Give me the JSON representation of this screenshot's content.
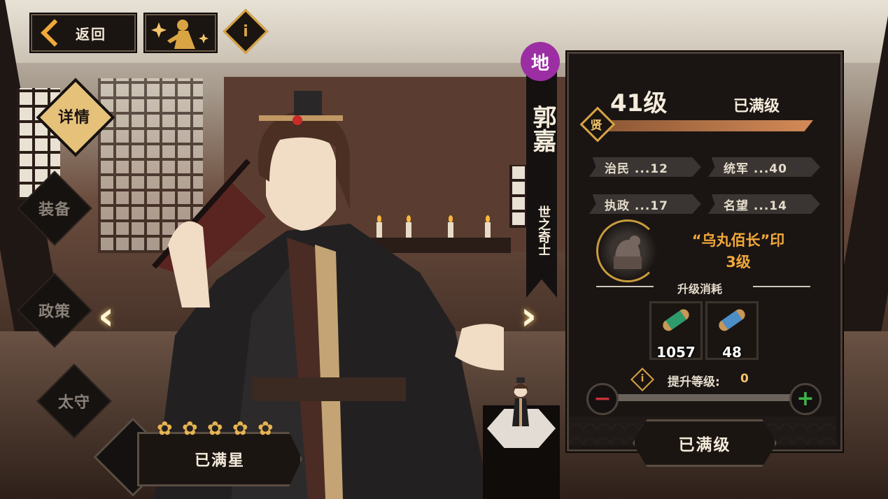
{
  "header": {
    "back_label": "返回",
    "info_glyph": "i"
  },
  "sidebar": {
    "items": [
      {
        "label": "详情",
        "active": true
      },
      {
        "label": "装备",
        "active": false
      },
      {
        "label": "政策",
        "active": false
      },
      {
        "label": "太守",
        "active": false
      }
    ]
  },
  "hero": {
    "rank_badge": "地",
    "name": "郭嘉",
    "title": "世之奇士",
    "star_count": 5,
    "star_status": "已满星"
  },
  "panel": {
    "level": "41级",
    "level_status": "已满级",
    "rank_label": "贤",
    "xp_progress": 1.0,
    "stats": [
      {
        "text": "治民 ...12"
      },
      {
        "text": "统军 ...40"
      },
      {
        "text": "执政 ...17"
      },
      {
        "text": "名望 ...14"
      }
    ],
    "seal": {
      "name": "“乌丸佰长”印",
      "level": "3级"
    },
    "cost_title": "升级消耗",
    "items": [
      {
        "icon": "green-scroll-icon",
        "count": "1057"
      },
      {
        "icon": "blue-scroll-icon",
        "count": "48"
      }
    ],
    "upgrade_label": "提升等级:",
    "upgrade_value": "0",
    "minus_glyph": "−",
    "plus_glyph": "+",
    "max_button": "已满级"
  },
  "colors": {
    "accent": "#d9a443",
    "rank_purple": "#9c2ea3",
    "seal_text": "#f2a93b"
  }
}
